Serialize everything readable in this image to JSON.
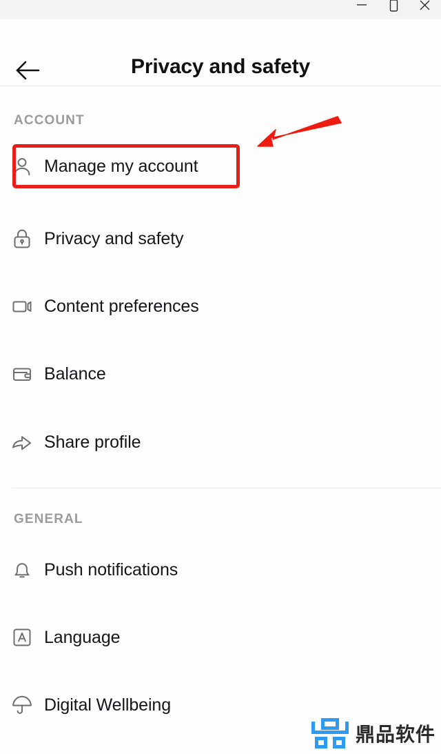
{
  "window": {
    "controls": [
      {
        "name": "minimize",
        "glyph": "minimize-icon",
        "label": "Minimize"
      },
      {
        "name": "maximize",
        "glyph": "maximize-icon",
        "label": "Maximize"
      },
      {
        "name": "close",
        "glyph": "close-icon",
        "label": "Close"
      }
    ]
  },
  "header": {
    "back_icon": "arrow-left-icon",
    "title": "Privacy and safety"
  },
  "sections": [
    {
      "key": "account",
      "label": "ACCOUNT",
      "items": [
        {
          "label": "Manage my account",
          "icon": "person-icon",
          "highlighted": true
        },
        {
          "label": "Privacy and safety",
          "icon": "lock-icon",
          "highlighted": false
        },
        {
          "label": "Content preferences",
          "icon": "video-camera-icon",
          "highlighted": false
        },
        {
          "label": "Balance",
          "icon": "wallet-icon",
          "highlighted": false
        },
        {
          "label": "Share profile",
          "icon": "share-arrow-icon",
          "highlighted": false
        }
      ]
    },
    {
      "key": "general",
      "label": "GENERAL",
      "items": [
        {
          "label": "Push notifications",
          "icon": "bell-icon",
          "highlighted": false
        },
        {
          "label": "Language",
          "icon": "letter-a-box-icon",
          "highlighted": false
        },
        {
          "label": "Digital Wellbeing",
          "icon": "umbrella-icon",
          "highlighted": false
        }
      ]
    }
  ],
  "annotation": {
    "highlight_color": "#e81e18",
    "arrow_color": "#ee1b11",
    "arrow_name": "pointer-arrow"
  },
  "watermark": {
    "text": "鼎品软件",
    "logo_color": "#2f9bf0",
    "logo_name": "dingpin-logo-icon"
  }
}
